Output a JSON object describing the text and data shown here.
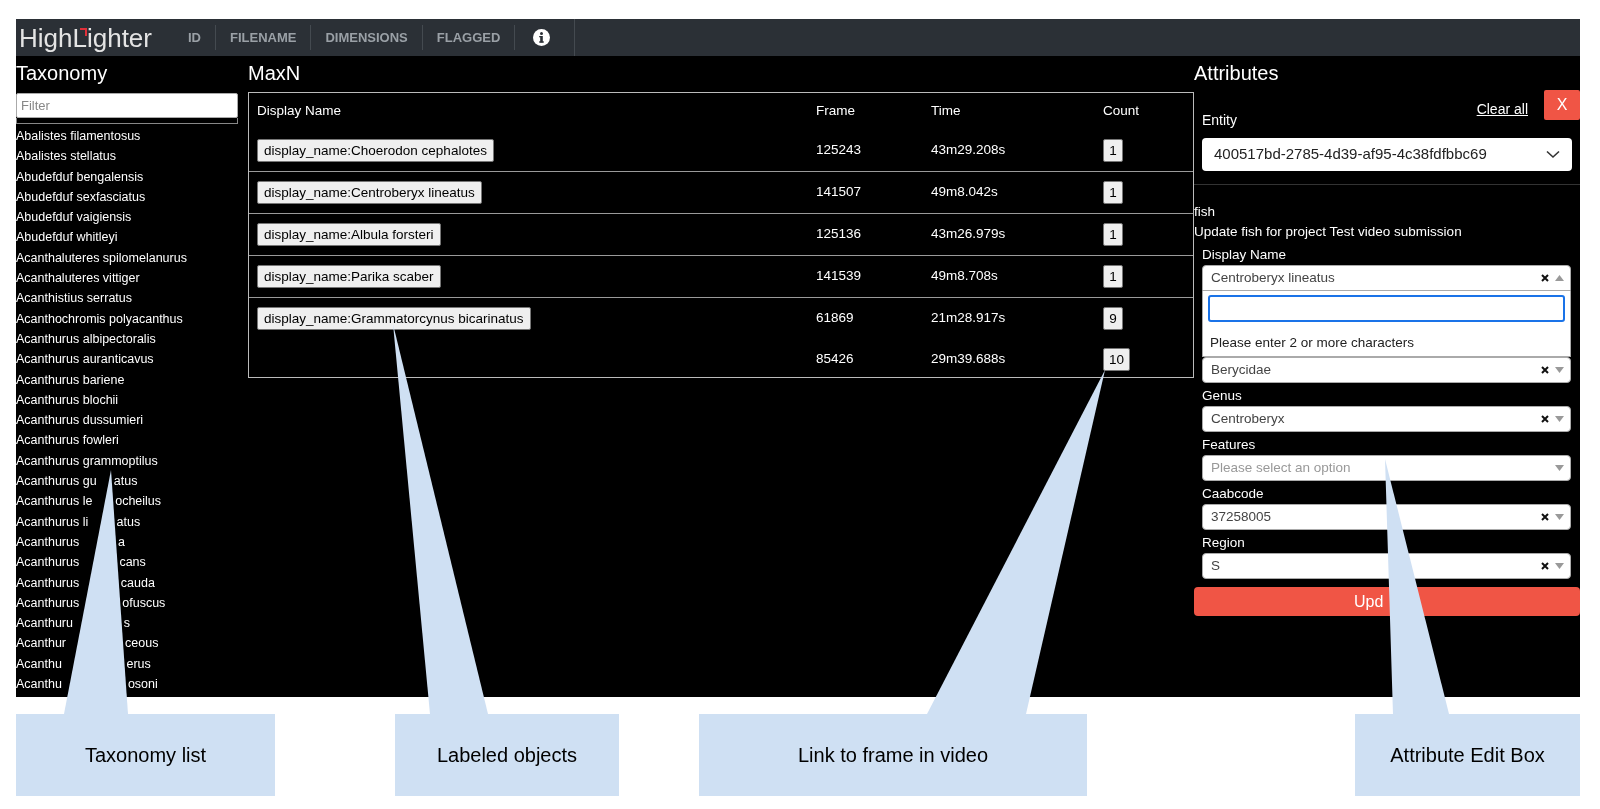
{
  "navbar": {
    "logo": "HighLighter",
    "items": [
      {
        "label": "ID"
      },
      {
        "label": "FILENAME"
      },
      {
        "label": "DIMENSIONS"
      },
      {
        "label": "FLAGGED"
      }
    ]
  },
  "taxonomy": {
    "title": "Taxonomy",
    "filter": {
      "placeholder": "Filter"
    },
    "items": [
      {
        "parts": [
          "Abalistes filamentosus"
        ]
      },
      {
        "parts": [
          "Abalistes stellatus"
        ]
      },
      {
        "parts": [
          "Abudefduf bengalensis"
        ]
      },
      {
        "parts": [
          "Abudefduf sexfasciatus"
        ]
      },
      {
        "parts": [
          "Abudefduf vaigiensis"
        ]
      },
      {
        "parts": [
          "Abudefduf whitleyi"
        ]
      },
      {
        "parts": [
          "Acanthaluteres spilomelanurus"
        ]
      },
      {
        "parts": [
          "Acanthaluteres vittiger"
        ]
      },
      {
        "parts": [
          "Acanthistius serratus"
        ]
      },
      {
        "parts": [
          "Acanthochromis polyacanthus"
        ]
      },
      {
        "parts": [
          "Acanthurus albipectoralis"
        ]
      },
      {
        "parts": [
          "Acanthurus auranticavus"
        ]
      },
      {
        "parts": [
          "Acanthurus bariene"
        ]
      },
      {
        "parts": [
          "Acanthurus blochii"
        ]
      },
      {
        "parts": [
          "Acanthurus dussumieri"
        ]
      },
      {
        "parts": [
          "Acanthurus fowleri"
        ]
      },
      {
        "parts": [
          "Acanthurus grammoptilus"
        ]
      },
      {
        "parts": [
          "Acanthurus gu",
          "atus"
        ]
      },
      {
        "parts": [
          "Acanthurus le",
          "ocheilus"
        ]
      },
      {
        "parts": [
          "Acanthurus li",
          "atus"
        ]
      },
      {
        "parts": [
          "Acanthurus",
          "a"
        ]
      },
      {
        "parts": [
          "Acanthurus",
          "cans"
        ]
      },
      {
        "parts": [
          "Acanthurus",
          "cauda"
        ]
      },
      {
        "parts": [
          "Acanthurus",
          "ofuscus"
        ]
      },
      {
        "parts": [
          "Acanthuru",
          "s"
        ]
      },
      {
        "parts": [
          "Acanthur",
          "ceous"
        ]
      },
      {
        "parts": [
          "Acanthu",
          "erus"
        ]
      },
      {
        "parts": [
          "Acanthu",
          "osoni"
        ]
      }
    ]
  },
  "maxn": {
    "title": "MaxN",
    "columns": [
      "Display Name",
      "Frame",
      "Time",
      "Count"
    ],
    "rows": [
      {
        "display_name": "display_name:Choerodon cephalotes",
        "entries": [
          {
            "frame": "125243",
            "time": "43m29.208s",
            "count": "1"
          }
        ]
      },
      {
        "display_name": "display_name:Centroberyx lineatus",
        "entries": [
          {
            "frame": "141507",
            "time": "49m8.042s",
            "count": "1"
          }
        ]
      },
      {
        "display_name": "display_name:Albula forsteri",
        "entries": [
          {
            "frame": "125136",
            "time": "43m26.979s",
            "count": "1"
          }
        ]
      },
      {
        "display_name": "display_name:Parika scaber",
        "entries": [
          {
            "frame": "141539",
            "time": "49m8.708s",
            "count": "1"
          }
        ]
      },
      {
        "display_name": "display_name:Grammatorcynus bicarinatus",
        "entries": [
          {
            "frame": "61869",
            "time": "21m28.917s",
            "count": "9"
          },
          {
            "frame": "85426",
            "time": "29m39.688s",
            "count": "10"
          }
        ]
      }
    ]
  },
  "attributes": {
    "title": "Attributes",
    "clear_all": "Clear all",
    "close_button": "X",
    "entity": {
      "label": "Entity",
      "value": "400517bd-2785-4d39-af95-4c38fdfbbc69"
    },
    "entity_type": "fish",
    "description": "Update fish for project Test video submission",
    "fields": [
      {
        "label": "Display Name",
        "value": "Centroberyx lineatus",
        "expanded": true,
        "dropdown": {
          "message": "Please enter 2 or more characters"
        }
      },
      {
        "value": "Berycidae",
        "expanded": false
      },
      {
        "label": "Genus",
        "value": "Centroberyx",
        "expanded": false
      },
      {
        "label": "Features",
        "placeholder": "Please select an option",
        "expanded": false
      },
      {
        "label": "Caabcode",
        "value": "37258005",
        "expanded": false
      },
      {
        "label": "Region",
        "value": "S",
        "expanded": false
      }
    ],
    "submit_button": "Upd"
  },
  "callouts": [
    {
      "text": "Taxonomy list"
    },
    {
      "text": "Labeled objects"
    },
    {
      "text": "Link to frame in video"
    },
    {
      "text": "Attribute Edit Box"
    }
  ]
}
